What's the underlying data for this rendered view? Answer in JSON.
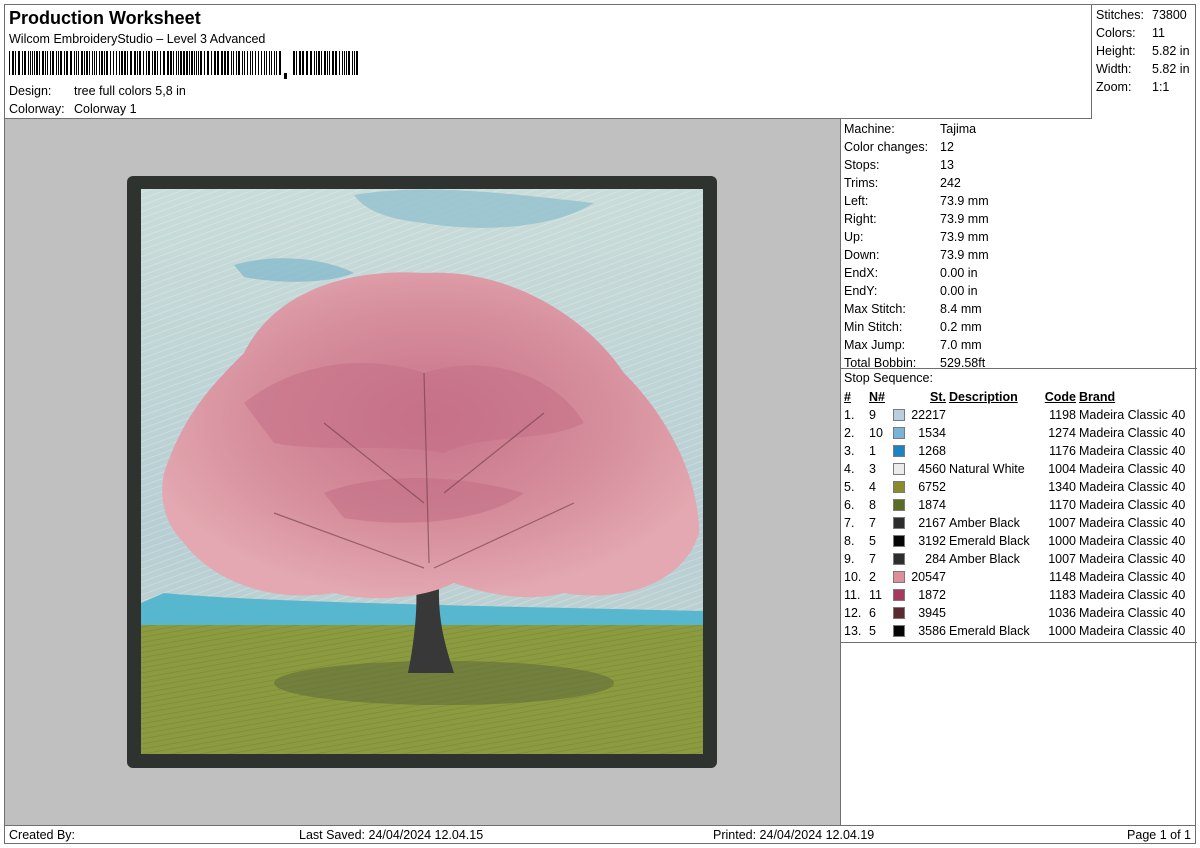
{
  "header": {
    "title": "Production Worksheet",
    "software": "Wilcom EmbroideryStudio – Level 3 Advanced",
    "design_label": "Design:",
    "design_value": "tree full colors 5,8 in",
    "colorway_label": "Colorway:",
    "colorway_value": "Colorway 1"
  },
  "stats": [
    {
      "label": "Stitches:",
      "value": "73800"
    },
    {
      "label": "Colors:",
      "value": "11"
    },
    {
      "label": "Height:",
      "value": "5.82 in"
    },
    {
      "label": "Width:",
      "value": "5.82 in"
    },
    {
      "label": "Zoom:",
      "value": "1:1"
    }
  ],
  "machine": [
    {
      "label": "Machine:",
      "value": "Tajima"
    },
    {
      "label": "Color changes:",
      "value": "12"
    },
    {
      "label": "Stops:",
      "value": "13"
    },
    {
      "label": "Trims:",
      "value": "242"
    },
    {
      "label": "Left:",
      "value": "73.9 mm"
    },
    {
      "label": "Right:",
      "value": "73.9 mm"
    },
    {
      "label": "Up:",
      "value": "73.9 mm"
    },
    {
      "label": "Down:",
      "value": "73.9 mm"
    },
    {
      "label": "EndX:",
      "value": "0.00 in"
    },
    {
      "label": "EndY:",
      "value": "0.00 in"
    },
    {
      "label": "Max Stitch:",
      "value": "8.4 mm"
    },
    {
      "label": "Min Stitch:",
      "value": "0.2 mm"
    },
    {
      "label": "Max Jump:",
      "value": "7.0 mm"
    },
    {
      "label": "Total Bobbin:",
      "value": "529.58ft"
    }
  ],
  "stop_sequence": {
    "title": "Stop Sequence:",
    "headers": {
      "idx": "#",
      "n": "N#",
      "st": "St.",
      "desc": "Description",
      "code": "Code",
      "brand": "Brand"
    },
    "rows": [
      {
        "idx": "1.",
        "n": "9",
        "color": "#b9cfe0",
        "st": "22217",
        "desc": "",
        "code": "1198",
        "brand": "Madeira Classic 40"
      },
      {
        "idx": "2.",
        "n": "10",
        "color": "#79b4d6",
        "st": "1534",
        "desc": "",
        "code": "1274",
        "brand": "Madeira Classic 40"
      },
      {
        "idx": "3.",
        "n": "1",
        "color": "#1d84c3",
        "st": "1268",
        "desc": "",
        "code": "1176",
        "brand": "Madeira Classic 40"
      },
      {
        "idx": "4.",
        "n": "3",
        "color": "#ebebeb",
        "st": "4560",
        "desc": "Natural White",
        "code": "1004",
        "brand": "Madeira Classic 40"
      },
      {
        "idx": "5.",
        "n": "4",
        "color": "#8c8b2c",
        "st": "6752",
        "desc": "",
        "code": "1340",
        "brand": "Madeira Classic 40"
      },
      {
        "idx": "6.",
        "n": "8",
        "color": "#5a6d27",
        "st": "1874",
        "desc": "",
        "code": "1170",
        "brand": "Madeira Classic 40"
      },
      {
        "idx": "7.",
        "n": "7",
        "color": "#2d2d2d",
        "st": "2167",
        "desc": "Amber Black",
        "code": "1007",
        "brand": "Madeira Classic 40"
      },
      {
        "idx": "8.",
        "n": "5",
        "color": "#050505",
        "st": "3192",
        "desc": "Emerald Black",
        "code": "1000",
        "brand": "Madeira Classic 40"
      },
      {
        "idx": "9.",
        "n": "7",
        "color": "#2d2d2d",
        "st": "284",
        "desc": "Amber Black",
        "code": "1007",
        "brand": "Madeira Classic 40"
      },
      {
        "idx": "10.",
        "n": "2",
        "color": "#dd8f9a",
        "st": "20547",
        "desc": "",
        "code": "1148",
        "brand": "Madeira Classic 40"
      },
      {
        "idx": "11.",
        "n": "11",
        "color": "#a8395e",
        "st": "1872",
        "desc": "",
        "code": "1183",
        "brand": "Madeira Classic 40"
      },
      {
        "idx": "12.",
        "n": "6",
        "color": "#5c2a2e",
        "st": "3945",
        "desc": "",
        "code": "1036",
        "brand": "Madeira Classic 40"
      },
      {
        "idx": "13.",
        "n": "5",
        "color": "#050505",
        "st": "3586",
        "desc": "Emerald Black",
        "code": "1000",
        "brand": "Madeira Classic 40"
      }
    ]
  },
  "footer": {
    "created": "Created By:",
    "saved": "Last Saved: 24/04/2024 12.04.15",
    "printed": "Printed: 24/04/2024 12.04.19",
    "page": "Page 1 of 1"
  },
  "preview": {
    "background": "#c0c0c0",
    "border_color": "#2f332f",
    "sky_color": "#b9d0d6",
    "grass_color": "#8c9a40",
    "blossom_color": "#dc98a4",
    "trunk_color": "#383838"
  }
}
